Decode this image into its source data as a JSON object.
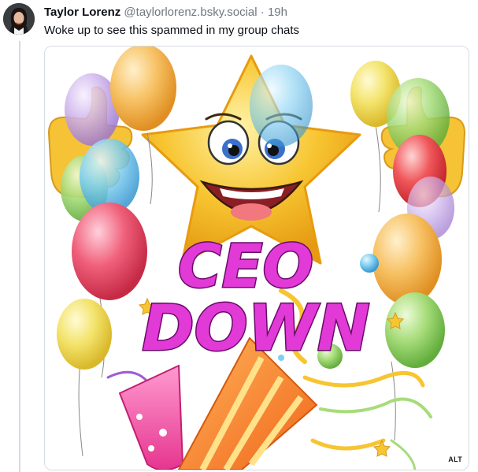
{
  "post": {
    "author_name": "Taylor Lorenz",
    "handle": "@taylorlorenz.bsky.social",
    "separator": "·",
    "time": "19h",
    "text": "Woke up to see this spammed in my group chats"
  },
  "image": {
    "caption_line1": "CEO",
    "caption_line2": "DOWN",
    "alt_badge": "ALT"
  },
  "colors": {
    "text_primary": "#0b0f14",
    "text_secondary": "#6f7780",
    "border": "#d4dbe2",
    "caption_fill": "#e13ad6",
    "star": "#f7c531"
  }
}
